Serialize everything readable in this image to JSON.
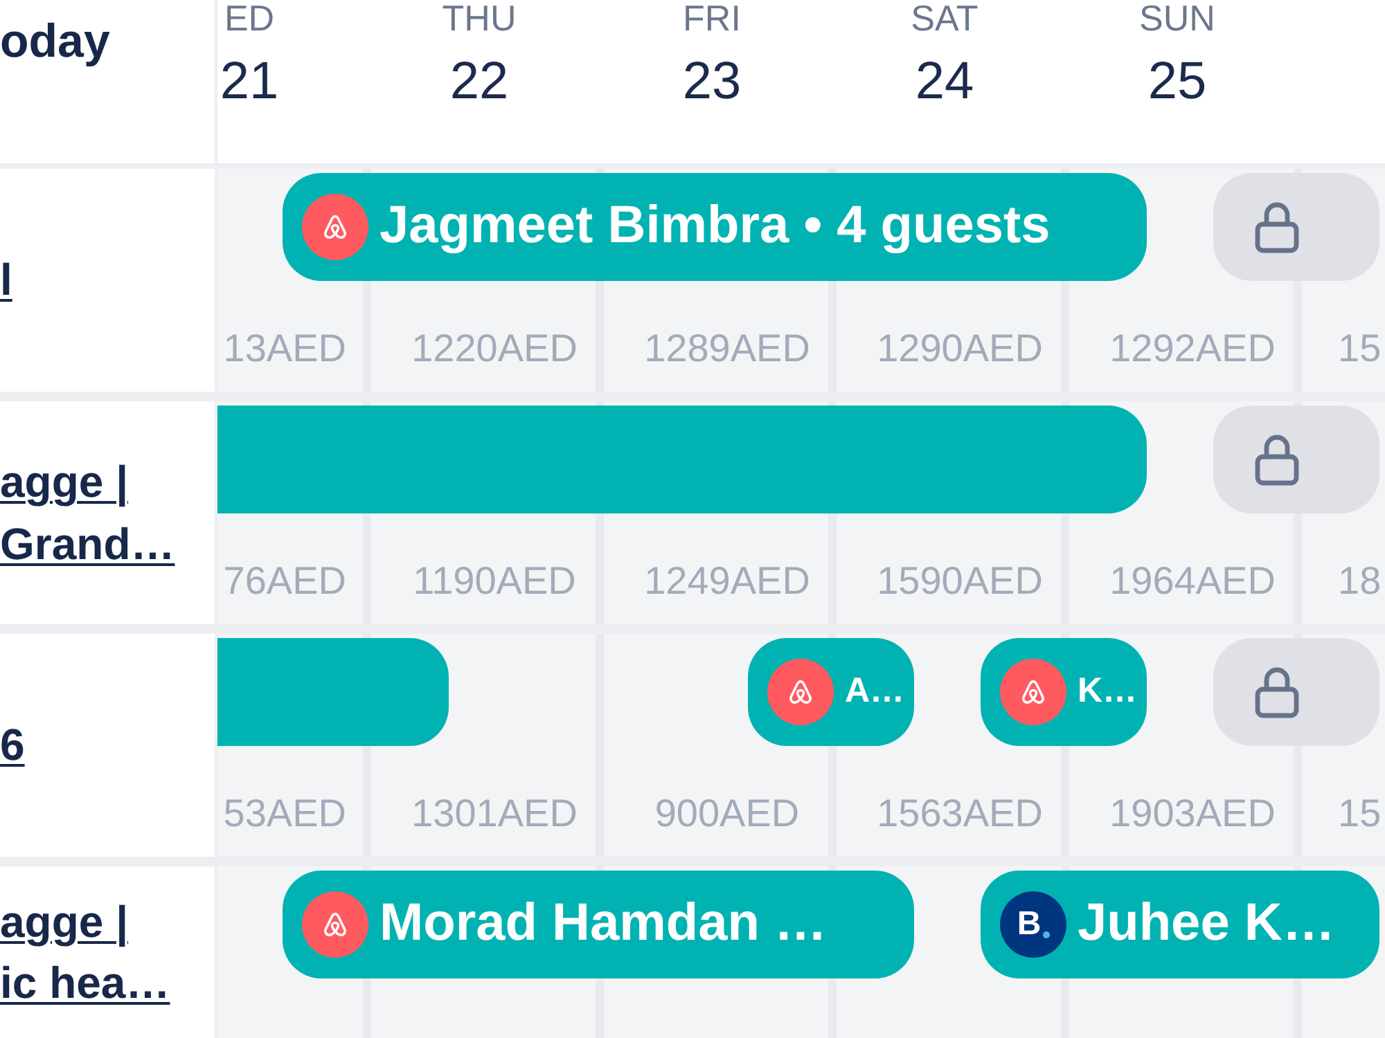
{
  "header": {
    "today": "oday",
    "days": [
      {
        "name": "ED",
        "date": "21"
      },
      {
        "name": "THU",
        "date": "22"
      },
      {
        "name": "FRI",
        "date": "23"
      },
      {
        "name": "SAT",
        "date": "24"
      },
      {
        "name": "SUN",
        "date": "25"
      }
    ]
  },
  "rows": [
    {
      "listing": [
        "l"
      ],
      "stays": [
        {
          "kind": "airbnb",
          "continued": false,
          "label": "Jagmeet Bimbra • 4 guests",
          "nights": [
            {
              "price": "13AED",
              "booked": true
            },
            {
              "price": "1220AED",
              "booked": true
            },
            {
              "price": "1289AED",
              "booked": true
            },
            {
              "price": "1290AED",
              "booked": true
            }
          ]
        },
        {
          "kind": "blocked",
          "continued": false,
          "nights": [
            {
              "price": "1292AED",
              "booked": true
            }
          ]
        },
        {
          "nights": [
            {
              "price": "15",
              "booked": false
            }
          ]
        }
      ]
    },
    {
      "listing": [
        "agge |",
        "Grand…"
      ],
      "stays": [
        {
          "kind": "reservation",
          "continued": true,
          "nights": [
            {
              "price": "76AED",
              "booked": true
            },
            {
              "price": "1190AED",
              "booked": true
            },
            {
              "price": "1249AED",
              "booked": true
            },
            {
              "price": "1590AED",
              "booked": true
            }
          ]
        },
        {
          "kind": "blocked",
          "continued": false,
          "nights": [
            {
              "price": "1964AED",
              "booked": true
            }
          ]
        },
        {
          "nights": [
            {
              "price": "18",
              "booked": false
            }
          ]
        }
      ]
    },
    {
      "listing": [
        "6"
      ],
      "stays": [
        {
          "kind": "reservation",
          "continued": true,
          "nights": [
            {
              "price": "53AED",
              "booked": true
            }
          ]
        },
        {
          "nights": [
            {
              "price": "1301AED",
              "booked": false
            }
          ]
        },
        {
          "kind": "airbnb",
          "continued": false,
          "label": "A…",
          "nights": [
            {
              "price": "900AED",
              "booked": true
            }
          ]
        },
        {
          "kind": "airbnb",
          "continued": false,
          "label": "K…",
          "nights": [
            {
              "price": "1563AED",
              "booked": true
            }
          ]
        },
        {
          "kind": "blocked",
          "continued": false,
          "nights": [
            {
              "price": "1903AED",
              "booked": true
            }
          ]
        },
        {
          "nights": [
            {
              "price": "15",
              "booked": false
            }
          ]
        }
      ]
    },
    {
      "listing": [
        "agge |",
        "ic hea…"
      ],
      "stays": [
        {
          "kind": "airbnb",
          "continued": false,
          "label": "Morad Hamdan …",
          "nights": [
            {
              "booked": true
            },
            {
              "booked": true
            },
            {
              "booked": true
            }
          ]
        },
        {
          "kind": "booking",
          "continued": false,
          "logo_text": "B",
          "label": "Juhee K…",
          "nights": [
            {
              "booked": true
            },
            {
              "booked": true
            }
          ]
        }
      ]
    }
  ]
}
